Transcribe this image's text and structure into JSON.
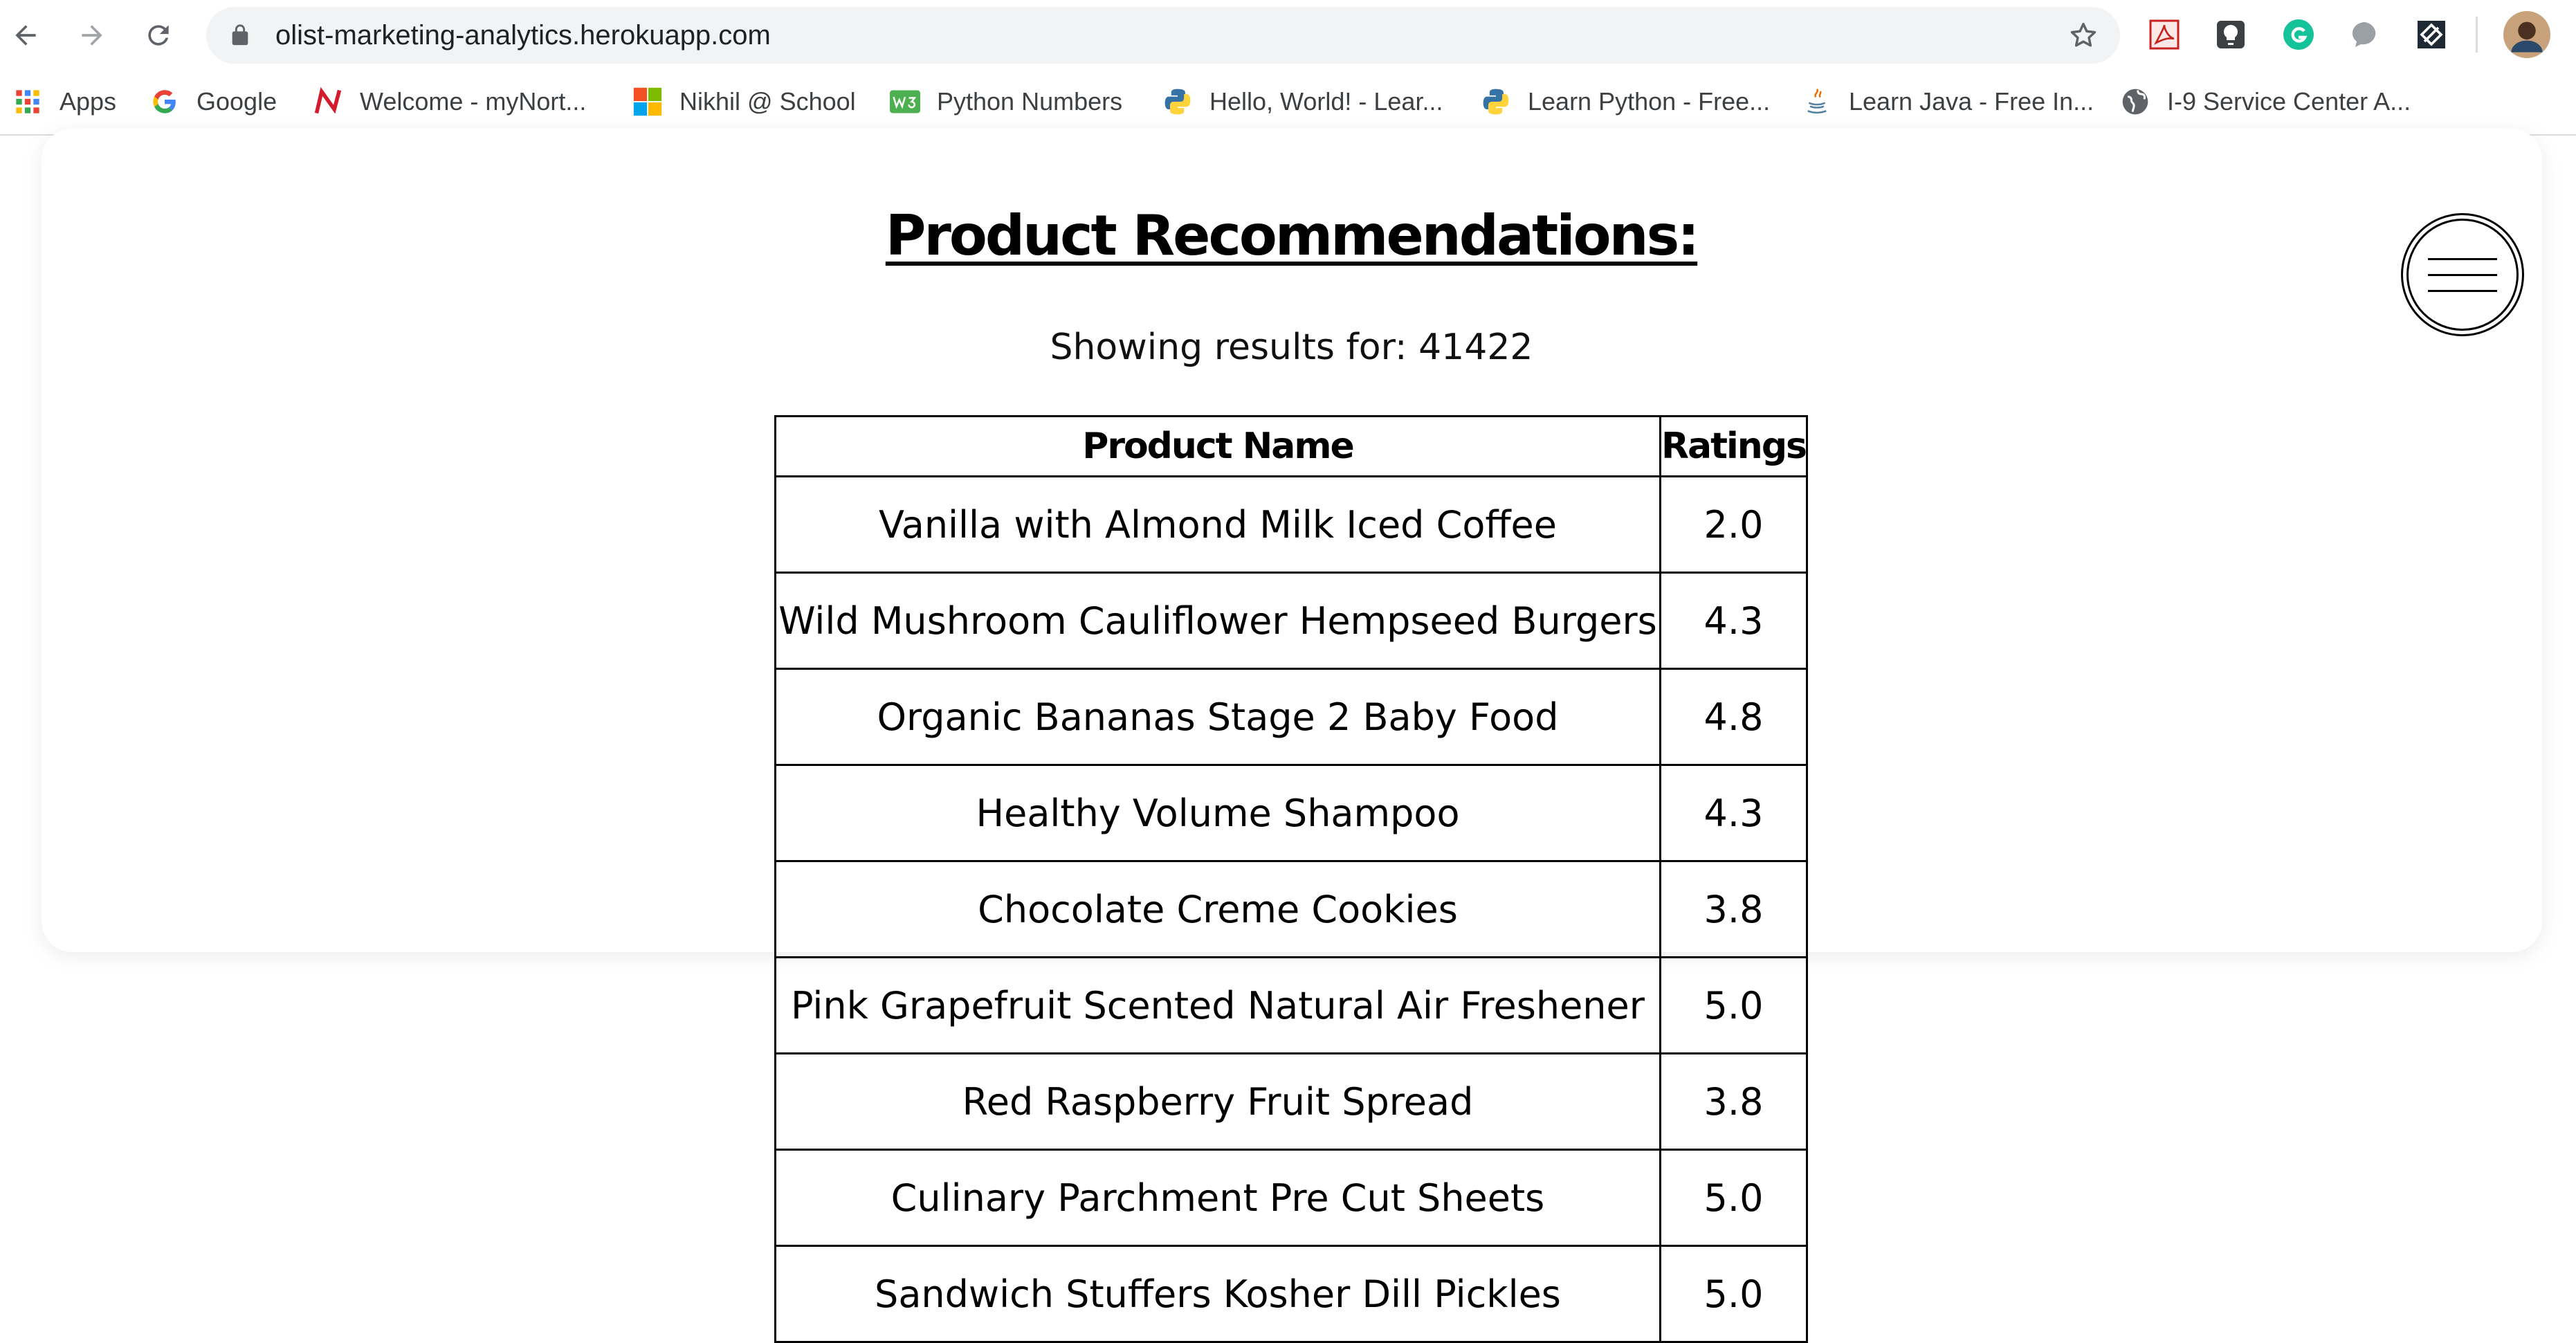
{
  "browser": {
    "url": "olist-marketing-analytics.herokuapp.com",
    "nav": {
      "back_icon": "back-arrow-icon",
      "forward_icon": "forward-arrow-icon",
      "reload_icon": "reload-icon"
    },
    "bookmarks": [
      {
        "label": "Apps",
        "icon": "apps-grid-icon"
      },
      {
        "label": "Google",
        "icon": "google-icon"
      },
      {
        "label": "Welcome - myNort...",
        "icon": "northeastern-icon"
      },
      {
        "label": "Nikhil @ School",
        "icon": "microsoft-icon"
      },
      {
        "label": "Python Numbers",
        "icon": "w3schools-icon"
      },
      {
        "label": "Hello, World! - Lear...",
        "icon": "python-icon"
      },
      {
        "label": "Learn Python - Free...",
        "icon": "python-icon"
      },
      {
        "label": "Learn Java - Free In...",
        "icon": "java-icon"
      },
      {
        "label": "I-9 Service Center A...",
        "icon": "globe-icon"
      }
    ]
  },
  "page": {
    "title": "Product Recommendations:",
    "subtitle": "Showing results for: 41422",
    "menu_icon": "hamburger-menu-icon"
  },
  "table": {
    "headers": {
      "name": "Product Name",
      "rating": "Ratings"
    },
    "rows": [
      {
        "name": "Vanilla with Almond Milk Iced Coffee",
        "rating": "2.0"
      },
      {
        "name": "Wild Mushroom Cauliflower Hempseed Burgers",
        "rating": "4.3"
      },
      {
        "name": "Organic Bananas Stage 2 Baby Food",
        "rating": "4.8"
      },
      {
        "name": "Healthy Volume Shampoo",
        "rating": "4.3"
      },
      {
        "name": "Chocolate Creme Cookies",
        "rating": "3.8"
      },
      {
        "name": "Pink Grapefruit Scented Natural Air Freshener",
        "rating": "5.0"
      },
      {
        "name": "Red Raspberry Fruit Spread",
        "rating": "3.8"
      },
      {
        "name": "Culinary Parchment Pre Cut Sheets",
        "rating": "5.0"
      },
      {
        "name": "Sandwich Stuffers Kosher Dill Pickles",
        "rating": "5.0"
      }
    ]
  }
}
